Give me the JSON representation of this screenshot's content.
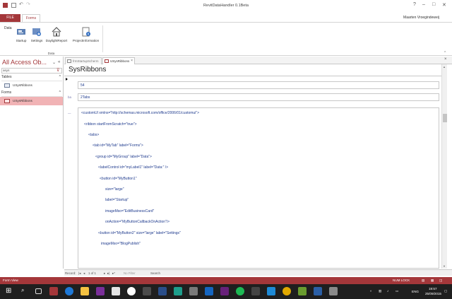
{
  "window": {
    "title": "RevitDataHandler 0.1Beta",
    "user": "Maarten Vroegindeweij"
  },
  "ribbon": {
    "tabs": [
      "FILE",
      "Forms"
    ],
    "side_label": "Data",
    "buttons": [
      {
        "label": "Startup",
        "icon": "startup-icon"
      },
      {
        "label": "Settings",
        "icon": "settings-icon"
      },
      {
        "label": "DaylightReport",
        "icon": "house-icon"
      },
      {
        "label": "ProjectInformation",
        "icon": "project-information-icon"
      }
    ],
    "group_label": "Data"
  },
  "nav": {
    "title": "All Access Ob...",
    "search_value": "asys",
    "sections": [
      {
        "title": "Tables",
        "items": [
          "USysRibbons"
        ]
      },
      {
        "title": "Forms",
        "items": [
          "USysRibbons"
        ]
      }
    ]
  },
  "doc_tabs": [
    "frmStartupScherm",
    "USysRibbons"
  ],
  "form": {
    "title": "SysRibbons",
    "id_value": "54",
    "name_value": "2Tabs",
    "row_mark": "ba",
    "xml_lines": [
      "<customUI xmlns=\"http://schemas.microsoft.com/office/2006/01/customui\">",
      "<ribbon startFromScratch=\"true\">",
      "<tabs>",
      "<tab id=\"MyTab\" label=\"Forms\">",
      "<group id=\"MyGroup\" label=\"Data\">",
      "<labelControl id=\"myLabel1\" label=\"Data:\" />",
      "<button id=\"MyButton1\"",
      "size=\"large\"",
      "label=\"Startup\"",
      "imageMso=\"EditBusinessCard\"",
      "onAction=\"MyButtonCallbackOnAction\"/>",
      "<button id=\"MyButton2\" size=\"large\" label=\"Settings\"",
      "imageMso=\"BlogPublish\""
    ]
  },
  "record_nav": {
    "record_label": "Record:",
    "position": "1 of 1",
    "filter": "No Filter",
    "search": "Search"
  },
  "status": {
    "left": "Form View",
    "num_lock": "NUM LOCK"
  },
  "taskbar": {
    "lang": "ENG",
    "time": "19:57",
    "date": "25/09/2015"
  },
  "colors": {
    "accent": "#a4373a",
    "link_text": "#1f3b8e"
  }
}
